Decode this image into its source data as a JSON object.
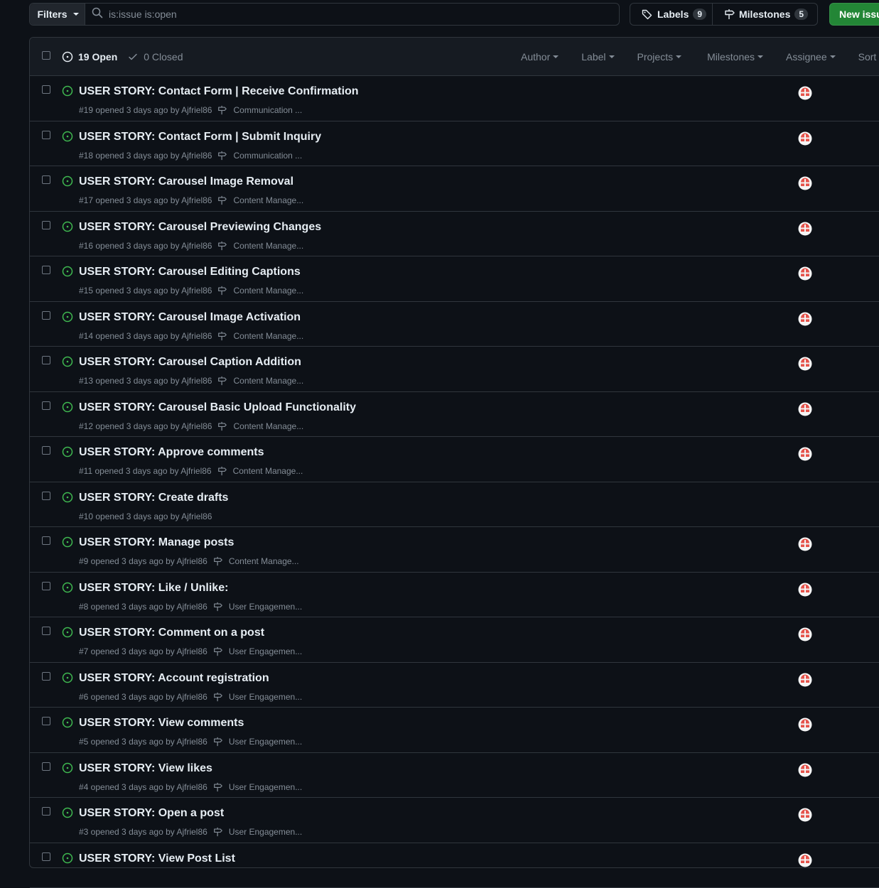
{
  "topbar": {
    "filters_label": "Filters",
    "search_value": "is:issue is:open",
    "labels_label": "Labels",
    "labels_count": "9",
    "milestones_label": "Milestones",
    "milestones_count": "5",
    "new_issue_label": "New issue"
  },
  "header": {
    "open_label": "19 Open",
    "closed_label": "0 Closed",
    "filters": [
      "Author",
      "Label",
      "Projects",
      "Milestones",
      "Assignee",
      "Sort"
    ]
  },
  "colors": {
    "open": "#3fb950",
    "accent_green": "#238636",
    "avatar": "#e5534b"
  },
  "issues": [
    {
      "title": "USER STORY: Contact Form | Receive Confirmation",
      "meta": "#19 opened 3 days ago by Ajfriel86",
      "milestone": "Communication ...",
      "avatar": true
    },
    {
      "title": "USER STORY: Contact Form | Submit Inquiry",
      "meta": "#18 opened 3 days ago by Ajfriel86",
      "milestone": "Communication ...",
      "avatar": true
    },
    {
      "title": "USER STORY: Carousel Image Removal",
      "meta": "#17 opened 3 days ago by Ajfriel86",
      "milestone": "Content Manage...",
      "avatar": true
    },
    {
      "title": "USER STORY: Carousel Previewing Changes",
      "meta": "#16 opened 3 days ago by Ajfriel86",
      "milestone": "Content Manage...",
      "avatar": true
    },
    {
      "title": "USER STORY: Carousel Editing Captions",
      "meta": "#15 opened 3 days ago by Ajfriel86",
      "milestone": "Content Manage...",
      "avatar": true
    },
    {
      "title": "USER STORY: Carousel Image Activation",
      "meta": "#14 opened 3 days ago by Ajfriel86",
      "milestone": "Content Manage...",
      "avatar": true
    },
    {
      "title": "USER STORY: Carousel Caption Addition",
      "meta": "#13 opened 3 days ago by Ajfriel86",
      "milestone": "Content Manage...",
      "avatar": true
    },
    {
      "title": "USER STORY: Carousel Basic Upload Functionality",
      "meta": "#12 opened 3 days ago by Ajfriel86",
      "milestone": "Content Manage...",
      "avatar": true
    },
    {
      "title": "USER STORY: Approve comments",
      "meta": "#11 opened 3 days ago by Ajfriel86",
      "milestone": "Content Manage...",
      "avatar": true
    },
    {
      "title": "USER STORY: Create drafts",
      "meta": "#10 opened 3 days ago by Ajfriel86",
      "milestone": "",
      "avatar": false
    },
    {
      "title": "USER STORY: Manage posts",
      "meta": "#9 opened 3 days ago by Ajfriel86",
      "milestone": "Content Manage...",
      "avatar": true
    },
    {
      "title": "USER STORY: Like / Unlike:",
      "meta": "#8 opened 3 days ago by Ajfriel86",
      "milestone": "User Engagemen...",
      "avatar": true
    },
    {
      "title": "USER STORY: Comment on a post",
      "meta": "#7 opened 3 days ago by Ajfriel86",
      "milestone": "User Engagemen...",
      "avatar": true
    },
    {
      "title": "USER STORY: Account registration",
      "meta": "#6 opened 3 days ago by Ajfriel86",
      "milestone": "User Engagemen...",
      "avatar": true
    },
    {
      "title": "USER STORY: View comments",
      "meta": "#5 opened 3 days ago by Ajfriel86",
      "milestone": "User Engagemen...",
      "avatar": true
    },
    {
      "title": "USER STORY: View likes",
      "meta": "#4 opened 3 days ago by Ajfriel86",
      "milestone": "User Engagemen...",
      "avatar": true
    },
    {
      "title": "USER STORY: Open a post",
      "meta": "#3 opened 3 days ago by Ajfriel86",
      "milestone": "User Engagemen...",
      "avatar": true
    },
    {
      "title": "USER STORY: View Post List",
      "meta": "",
      "milestone": "",
      "avatar": true
    }
  ]
}
